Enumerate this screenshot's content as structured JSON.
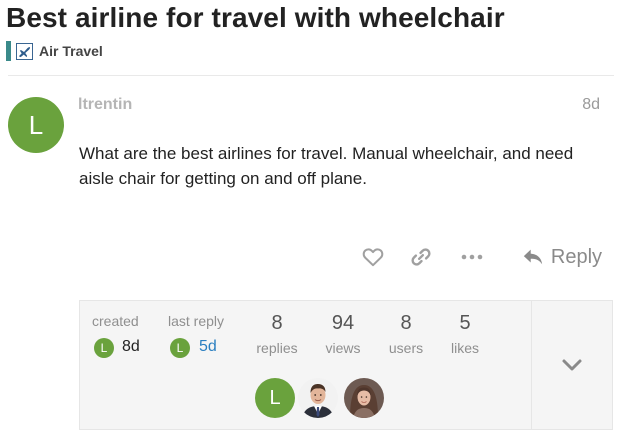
{
  "topic": {
    "title": "Best airline for travel with wheelchair",
    "category": {
      "name": "Air Travel",
      "bar_color": "#3a8a8a",
      "icon": "airplane-icon"
    }
  },
  "post": {
    "avatar_letter": "L",
    "avatar_color": "#6aa23d",
    "username": "ltrentin",
    "date": "8d",
    "body": "What are the best airlines for travel. Manual wheelchair, and need aisle chair for getting on and off plane."
  },
  "actions": {
    "like_icon": "heart-icon",
    "link_icon": "link-icon",
    "more_icon": "more-dots-icon",
    "reply_icon": "reply-arrow-icon",
    "reply_label": "Reply"
  },
  "summary": {
    "created_label": "created",
    "created_avatar": "L",
    "created_value": "8d",
    "last_reply_label": "last reply",
    "last_reply_avatar": "L",
    "last_reply_value": "5d",
    "stats": [
      {
        "number": "8",
        "label": "replies"
      },
      {
        "number": "94",
        "label": "views"
      },
      {
        "number": "8",
        "label": "users"
      },
      {
        "number": "5",
        "label": "likes"
      }
    ],
    "participants": [
      {
        "type": "letter",
        "letter": "L"
      },
      {
        "type": "photo",
        "description": "man-in-suit"
      },
      {
        "type": "photo",
        "description": "woman-long-hair"
      }
    ],
    "expand_icon": "chevron-down-icon"
  }
}
